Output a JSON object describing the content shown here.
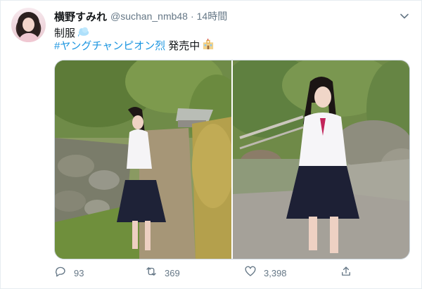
{
  "tweet": {
    "display_name": "横野すみれ",
    "handle": "@suchan_nmb48",
    "separator": "·",
    "time": "14時間",
    "text_line1": "制服",
    "hashtag": "#ヤングチャンピオン烈",
    "after_hashtag": "発売中",
    "emoji_line1": "cloud-emoji",
    "emoji_line2": "school-emoji"
  },
  "actions": {
    "reply_count": "93",
    "retweet_count": "369",
    "like_count": "3,398"
  },
  "icons": {
    "caret": "chevron-down-icon",
    "reply": "reply-icon",
    "retweet": "retweet-icon",
    "like": "heart-icon",
    "share": "share-icon"
  },
  "colors": {
    "link": "#1b95e0",
    "muted": "#657786",
    "text": "#14171a"
  }
}
